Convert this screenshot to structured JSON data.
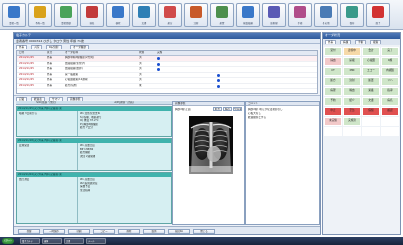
{
  "toolbar": {
    "buttons": [
      {
        "label": "患者一覧",
        "icon": "patient-list-icon",
        "color": "#3a78c9"
      },
      {
        "label": "予約一覧",
        "icon": "calendar-icon",
        "color": "#d9a21b"
      },
      {
        "label": "患者登録",
        "icon": "add-patient-icon",
        "color": "#4aa35a"
      },
      {
        "label": "病名",
        "icon": "diagnosis-icon",
        "color": "#c23b3b"
      },
      {
        "label": "検索",
        "icon": "search-icon",
        "color": "#3a78c9"
      },
      {
        "label": "文書",
        "icon": "document-icon",
        "color": "#2f7fb5"
      },
      {
        "label": "処方",
        "icon": "prescription-icon",
        "color": "#d04a4a"
      },
      {
        "label": "注射",
        "icon": "injection-icon",
        "color": "#c85a2a"
      },
      {
        "label": "処置",
        "icon": "treatment-icon",
        "color": "#4d8f4d"
      },
      {
        "label": "検査依頼",
        "icon": "lab-request-icon",
        "color": "#3a78c9"
      },
      {
        "label": "放射線",
        "icon": "radiology-icon",
        "color": "#5a5ab5"
      },
      {
        "label": "手術",
        "icon": "surgery-icon",
        "color": "#b04d8a"
      },
      {
        "label": "その他",
        "icon": "tools-icon",
        "color": "#4a7bb5"
      },
      {
        "label": "保存",
        "icon": "save-icon",
        "color": "#3a9a8a"
      },
      {
        "label": "終了",
        "icon": "exit-icon",
        "color": "#d23232"
      }
    ]
  },
  "main": {
    "title": "電子カルテ",
    "patient_line": "患者番号 0000314  ひがし  タロウ  男性  年齢  71歳",
    "tabs1": [
      "外来",
      "入院",
      "Rp/注射",
      "オーダ履歴"
    ],
    "order_table": {
      "columns": [
        "日付",
        "区分",
        "オーダ名称",
        "状態",
        "実施"
      ],
      "rows": [
        {
          "date": "2014/11/25",
          "kind": "外来",
          "name": "胸部単純X線撮影(2方向)",
          "status": "済"
        },
        {
          "date": "2014/11/25",
          "kind": "外来",
          "name": "血液検査(生化学)",
          "status": "済"
        },
        {
          "date": "2014/11/25",
          "kind": "外来",
          "name": "血液検査(血算)",
          "status": "済"
        },
        {
          "date": "2014/11/25",
          "kind": "外来",
          "name": "尿一般検査",
          "status": "済"
        },
        {
          "date": "2014/11/25",
          "kind": "外来",
          "name": "心電図検査(12誘導)",
          "status": "済"
        },
        {
          "date": "2014/11/25",
          "kind": "外来",
          "name": "処方(院外)",
          "status": "未"
        }
      ]
    },
    "tabs2": [
      "記載",
      "経過表",
      "サマリ",
      "画像参照"
    ],
    "soap_headers": [
      "S/O(主訴・所見)",
      "A/P(評価・計画)",
      "画像・シェーマ",
      "コメント"
    ],
    "entries": [
      {
        "header": "2014/11/25(火) 外来 内科 記載者:東",
        "left": "咳嗽 3日前から",
        "right": [
          "#1 急性気管支炎",
          "S) 咳嗽、喀痰あり",
          "O) 体温 37.2℃",
          "P) 胸部X線撮影",
          "処方 7日分"
        ]
      },
      {
        "header": "2014/11/18(火) 外来 内科 記載者:東",
        "left": "定期受診",
        "right": [
          "#1 高血圧症",
          "BP 138/82",
          "処方継続",
          "次回 2週間後"
        ]
      },
      {
        "header": "2014/11/04(火) 外来 内科 記載者:東",
        "left": "血圧測定",
        "right": [
          "#1 高血圧症",
          "#2 脂質異常症",
          "採血予定",
          "生活指導"
        ]
      }
    ],
    "viewer": {
      "header": "画像参照",
      "image_label": "胸部X線 正面",
      "tools": [
        "拡大",
        "縮小",
        "全画面"
      ]
    },
    "notes": {
      "header": "コメント",
      "lines": [
        "胸部X線: 明らかな浸潤影なし",
        "心拡大なし",
        "経過観察とする"
      ]
    },
    "bottom_buttons": [
      "登録",
      "一時保存",
      "印刷",
      "コピー",
      "削除",
      "取消",
      "前回Do",
      "閉じる"
    ]
  },
  "right_panel": {
    "title": "オーダ状況",
    "tabs": [
      "外来",
      "病棟",
      "手術",
      "検査"
    ],
    "cells": [
      {
        "text": "受付",
        "color": "#cfe6c9"
      },
      {
        "text": "診察中",
        "color": "#f6d9a8"
      },
      {
        "text": "会計",
        "color": "#cfe6c9"
      },
      {
        "text": "完了",
        "color": "#cfe6c9"
      },
      {
        "text": "採血",
        "color": "#f2c9c9"
      },
      {
        "text": "尿検",
        "color": "#cfe6c9"
      },
      {
        "text": "心電図",
        "color": "#cfe6c9"
      },
      {
        "text": "X線",
        "color": "#cfe6c9"
      },
      {
        "text": "CT",
        "color": "#cfe6c9"
      },
      {
        "text": "MRI",
        "color": "#cfe6c9"
      },
      {
        "text": "エコー",
        "color": "#cfe6c9"
      },
      {
        "text": "内視鏡",
        "color": "#cfe6c9"
      },
      {
        "text": "処方",
        "color": "#cfe6c9"
      },
      {
        "text": "注射",
        "color": "#cfe6c9"
      },
      {
        "text": "処置",
        "color": "#cfe6c9"
      },
      {
        "text": "リハ",
        "color": "#cfe6c9"
      },
      {
        "text": "病理",
        "color": "#cfe6c9"
      },
      {
        "text": "輸血",
        "color": "#cfe6c9"
      },
      {
        "text": "栄養",
        "color": "#cfe6c9"
      },
      {
        "text": "指導",
        "color": "#cfe6c9"
      },
      {
        "text": "予約",
        "color": "#cfe6c9"
      },
      {
        "text": "紹介",
        "color": "#cfe6c9"
      },
      {
        "text": "文書",
        "color": "#cfe6c9"
      },
      {
        "text": "病名",
        "color": "#cfe6c9"
      },
      {
        "text": "中止",
        "color": "#e05050"
      },
      {
        "text": "至急",
        "color": "#e05050"
      },
      {
        "text": "保留",
        "color": "#e05050"
      },
      {
        "text": "確認",
        "color": "#e05050"
      },
      {
        "text": "未実施",
        "color": "#f2c9c9"
      },
      {
        "text": "実施済",
        "color": "#cfe6c9"
      },
      {
        "text": "",
        "color": "#ffffff"
      },
      {
        "text": "",
        "color": "#ffffff"
      },
      {
        "text": "",
        "color": "#ffffff"
      },
      {
        "text": "",
        "color": "#ffffff"
      },
      {
        "text": "",
        "color": "#ffffff"
      },
      {
        "text": "",
        "color": "#ffffff"
      }
    ]
  },
  "taskbar": {
    "start_label": "スタート",
    "items": [
      "電子カルテ",
      "画像",
      "文書",
      "メール"
    ]
  }
}
